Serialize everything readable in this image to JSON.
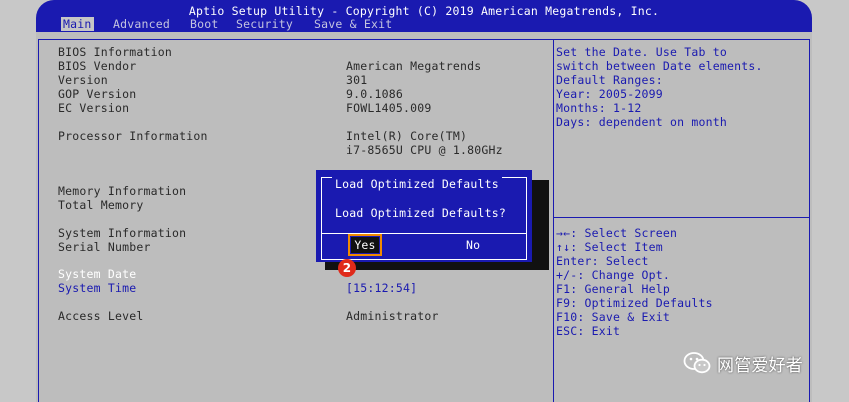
{
  "title": "Aptio Setup Utility - Copyright (C) 2019 American Megatrends, Inc.",
  "tabs": [
    {
      "label": "Main",
      "active": true
    },
    {
      "label": "Advanced",
      "active": false
    },
    {
      "label": "Boot",
      "active": false
    },
    {
      "label": "Security",
      "active": false
    },
    {
      "label": "Save & Exit",
      "active": false
    }
  ],
  "rows": [
    {
      "label": "BIOS Information",
      "value": ""
    },
    {
      "label": "BIOS Vendor",
      "value": "American Megatrends"
    },
    {
      "label": "Version",
      "value": "301"
    },
    {
      "label": "GOP Version",
      "value": "9.0.1086"
    },
    {
      "label": "EC Version",
      "value": "FOWL1405.009"
    },
    {
      "label": "Processor Information",
      "value": "Intel(R) Core(TM)"
    },
    {
      "label": "",
      "value": "i7-8565U CPU @ 1.80GHz"
    },
    {
      "label": "Memory Information",
      "value": ""
    },
    {
      "label": "Total Memory",
      "value": ""
    },
    {
      "label": "System Information",
      "value": ""
    },
    {
      "label": "Serial Number",
      "value": ""
    },
    {
      "label": "System Date",
      "value": ""
    },
    {
      "label": "System Time",
      "value": "[15:12:54]"
    },
    {
      "label": "Access Level",
      "value": "Administrator"
    }
  ],
  "help_text": [
    "Set the Date. Use Tab to",
    "switch between Date elements.",
    "Default Ranges:",
    "Year: 2005-2099",
    "Months: 1-12",
    "Days: dependent on month"
  ],
  "key_help": [
    "→←: Select Screen",
    "↑↓: Select Item",
    "Enter: Select",
    "+/-: Change Opt.",
    "F1: General Help",
    "F9: Optimized Defaults",
    "F10: Save & Exit",
    "ESC: Exit"
  ],
  "dialog": {
    "title": "Load Optimized Defaults",
    "message": "Load Optimized Defaults?",
    "yes_label": "Yes",
    "no_label": "No"
  },
  "annotation": {
    "step": "2",
    "color": "#e02a1a",
    "highlight_color": "#f08a00"
  },
  "watermark": {
    "icon": "wechat-icon",
    "text": "网管爱好者"
  },
  "colors": {
    "bios_blue": "#1a1ab0",
    "bios_gray": "#bdbdbd"
  }
}
